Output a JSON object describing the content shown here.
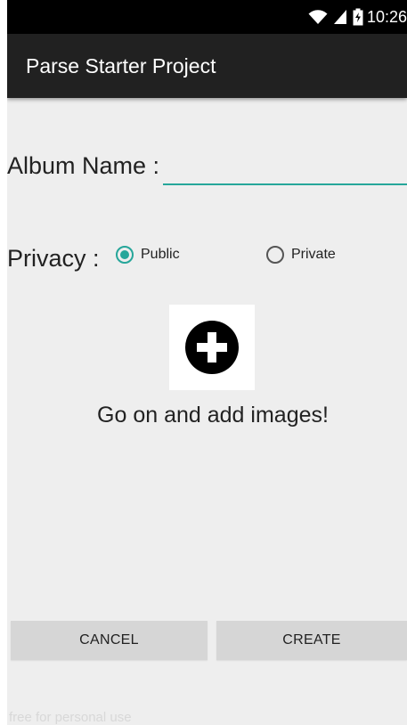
{
  "status_bar": {
    "time": "10:26",
    "icons": [
      "wifi-icon",
      "signal-icon",
      "battery-charging-icon"
    ]
  },
  "app_bar": {
    "title": "Parse Starter Project"
  },
  "form": {
    "album_label": "Album Name :",
    "album_value": "",
    "privacy_label": "Privacy :",
    "privacy_options": [
      {
        "label": "Public",
        "selected": true
      },
      {
        "label": "Private",
        "selected": false
      }
    ]
  },
  "add_images": {
    "icon": "add-circle-icon",
    "hint": "Go on and add images!"
  },
  "actions": {
    "cancel_label": "CANCEL",
    "create_label": "CREATE"
  },
  "watermark": "free for personal use",
  "colors": {
    "accent": "#26a69a",
    "app_bar": "#212121",
    "status_bar": "#000000",
    "background": "#eeeeee",
    "button": "#d6d6d6"
  }
}
